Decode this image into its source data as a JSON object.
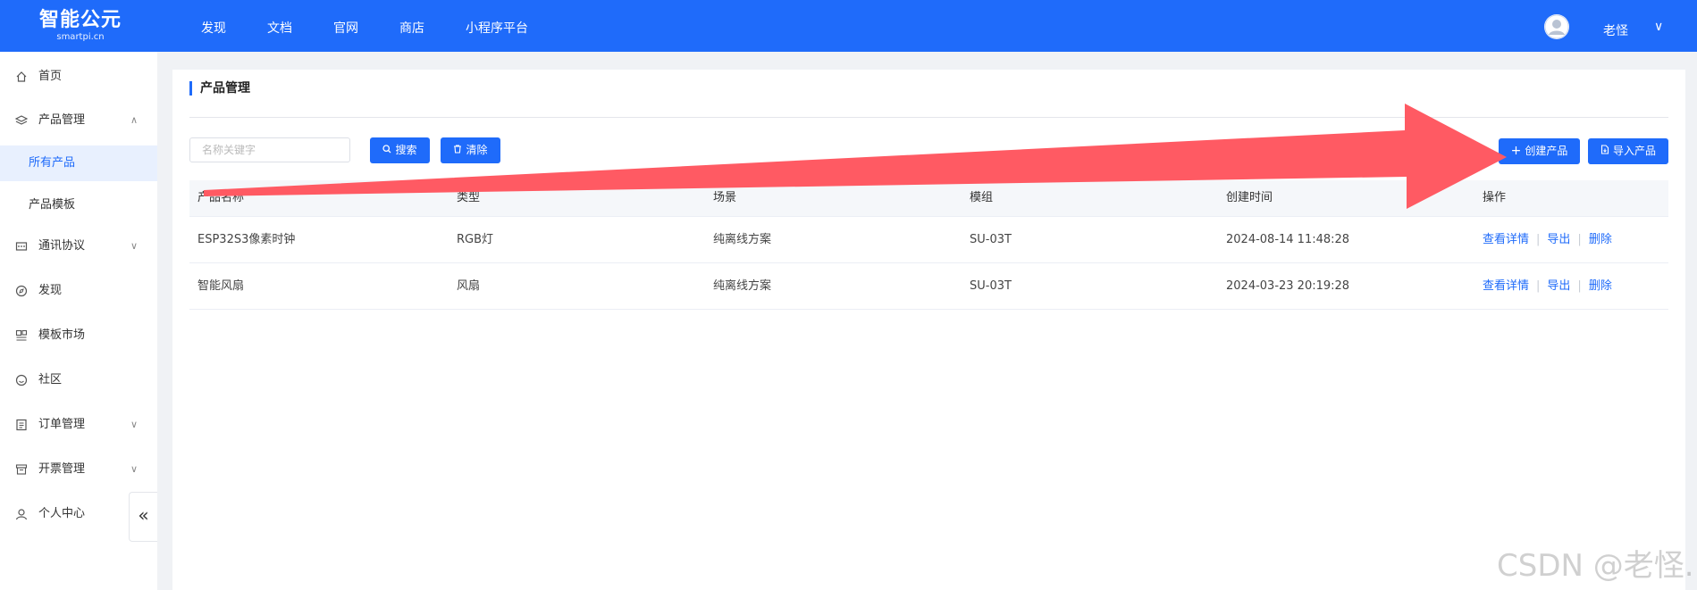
{
  "header": {
    "logo_main": "智能公元",
    "logo_sub": "smartpi.cn",
    "nav": [
      "发现",
      "文档",
      "官网",
      "商店",
      "小程序平台"
    ],
    "user_name": "老怪",
    "user_caret": "∨"
  },
  "sidebar": {
    "items": [
      {
        "label": "首页",
        "icon": "home-icon"
      },
      {
        "label": "产品管理",
        "icon": "layers-icon",
        "chevron": "∧"
      },
      {
        "label": "所有产品",
        "sub": true,
        "active": true
      },
      {
        "label": "产品模板",
        "sub": true
      },
      {
        "label": "通讯协议",
        "icon": "protocol-icon",
        "chevron": "∨"
      },
      {
        "label": "发现",
        "icon": "compass-icon"
      },
      {
        "label": "模板市场",
        "icon": "market-icon"
      },
      {
        "label": "社区",
        "icon": "community-icon"
      },
      {
        "label": "订单管理",
        "icon": "order-icon",
        "chevron": "∨"
      },
      {
        "label": "开票管理",
        "icon": "invoice-icon",
        "chevron": "∨"
      },
      {
        "label": "个人中心",
        "icon": "user-icon",
        "chevron": "∨"
      }
    ],
    "collapse_glyph": "«"
  },
  "main": {
    "title": "产品管理",
    "search_placeholder": "名称关键字",
    "search_button": "搜索",
    "clear_button": "清除",
    "create_button": "创建产品",
    "import_button": "导入产品",
    "table": {
      "headers": [
        "产品名称",
        "类型",
        "场景",
        "模组",
        "创建时间",
        "操作"
      ],
      "rows": [
        [
          "ESP32S3像素时钟",
          "RGB灯",
          "纯离线方案",
          "SU-03T",
          "2024-08-14 11:48:28"
        ],
        [
          "智能风扇",
          "风扇",
          "纯离线方案",
          "SU-03T",
          "2024-03-23 20:19:28"
        ]
      ],
      "actions": [
        "查看详情",
        "导出",
        "删除"
      ],
      "separator": "|"
    }
  },
  "annotation": {
    "arrow_color": "#ff5a63"
  },
  "watermark": "CSDN @老怪."
}
